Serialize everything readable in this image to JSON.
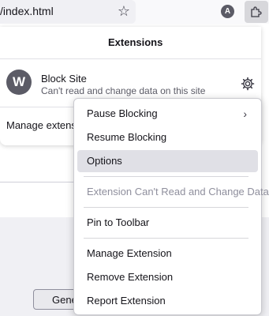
{
  "toolbar": {
    "url": "/index.html",
    "account_letter": "A",
    "icons": [
      "star-icon",
      "account-icon",
      "extensions-puzzle-icon"
    ]
  },
  "panel": {
    "title": "Extensions",
    "extension": {
      "logo_letter": "W",
      "name": "Block Site",
      "description": "Can't read and change data on this site"
    },
    "manage_label": "Manage extensions"
  },
  "context_menu": {
    "items": [
      {
        "label": "Pause Blocking",
        "submenu": true
      },
      {
        "label": "Resume Blocking"
      },
      {
        "label": "Options",
        "highlighted": true
      },
      {
        "label": "Extension Can't Read and Change Data",
        "disabled": true
      },
      {
        "label": "Pin to Toolbar"
      },
      {
        "label": "Manage Extension"
      },
      {
        "label": "Remove Extension"
      },
      {
        "label": "Report Extension"
      }
    ]
  },
  "background": {
    "button_label": "Gene"
  }
}
